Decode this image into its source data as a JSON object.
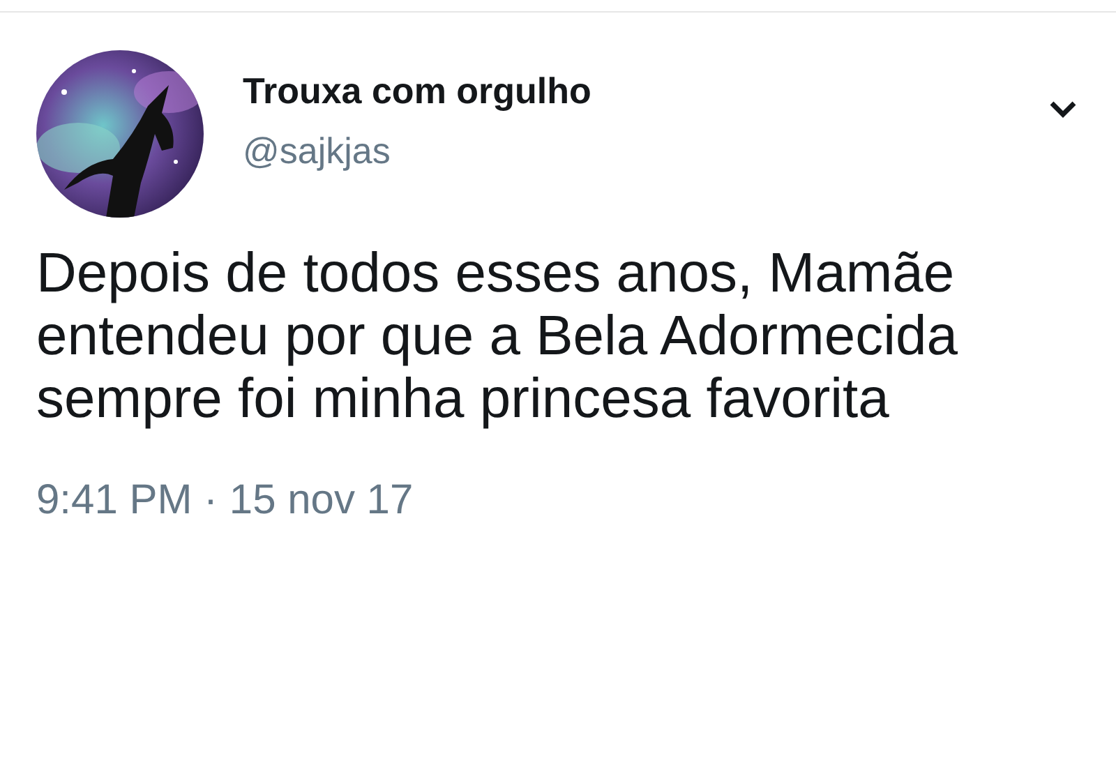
{
  "tweet": {
    "author": {
      "name": "Trouxa com orgulho",
      "handle": "@sajkjas"
    },
    "menu": {
      "kind": "chevron"
    },
    "text": "Depois de todos esses anos, Mamãe entendeu por que a Bela Adormecida sempre foi minha princesa favorita",
    "timestamp": "9:41 PM · 15 nov 17"
  }
}
